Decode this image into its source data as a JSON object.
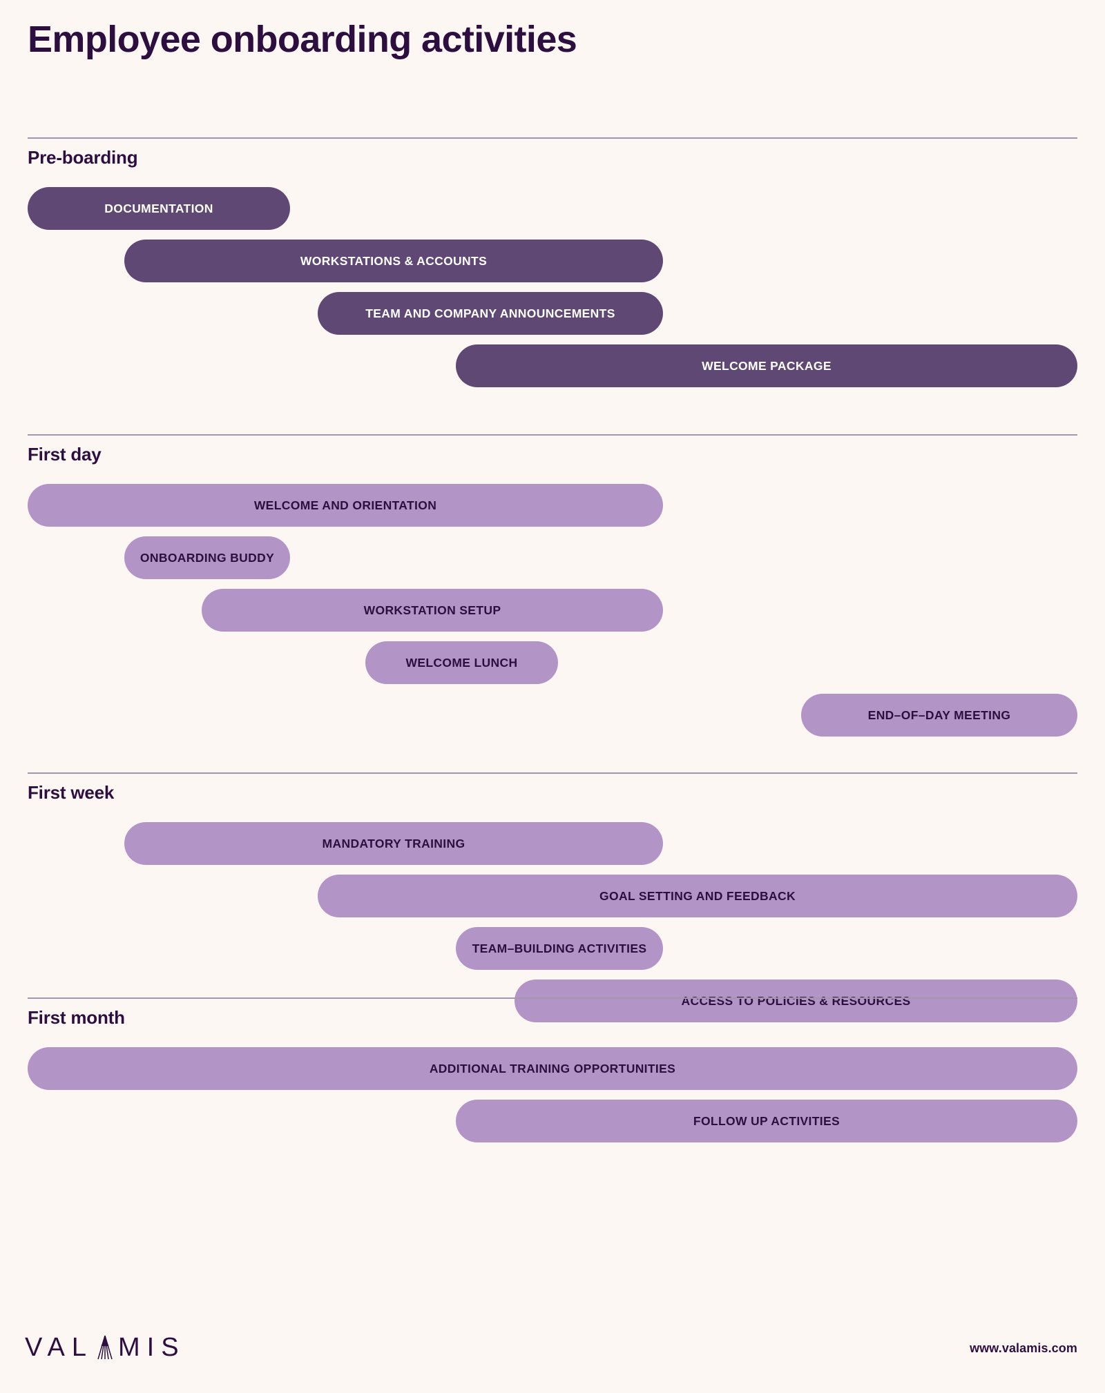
{
  "header": {
    "title": "Employee onboarding activities"
  },
  "colors": {
    "background": "#fdf7f4",
    "ink": "#2d0f3f",
    "bar_dark": "#5f4874",
    "bar_light": "#b294c6",
    "divider": "#a496ad"
  },
  "chart_data": {
    "type": "bar",
    "title": "Employee onboarding activities",
    "orientation": "horizontal",
    "xlabel": "",
    "ylabel": "",
    "grid": false,
    "legend": "none",
    "note": "Gantt-style staggered timeline bars; x extents are fractions of the 1520px content width",
    "sections": [
      {
        "label": "Pre-boarding",
        "color": "#5f4874",
        "bars": [
          {
            "label": "DOCUMENTATION",
            "start": 0.0,
            "end": 0.25
          },
          {
            "label": "WORKSTATIONS & ACCOUNTS",
            "start": 0.092,
            "end": 0.605
          },
          {
            "label": "TEAM AND COMPANY ANNOUNCEMENTS",
            "start": 0.276,
            "end": 0.605
          },
          {
            "label": "WELCOME PACKAGE",
            "start": 0.408,
            "end": 1.0
          }
        ]
      },
      {
        "label": "First day",
        "color": "#b294c6",
        "bars": [
          {
            "label": "WELCOME AND ORIENTATION",
            "start": 0.0,
            "end": 0.605
          },
          {
            "label": "ONBOARDING BUDDY",
            "start": 0.092,
            "end": 0.25
          },
          {
            "label": "WORKSTATION SETUP",
            "start": 0.166,
            "end": 0.605
          },
          {
            "label": "WELCOME LUNCH",
            "start": 0.322,
            "end": 0.505
          },
          {
            "label": "END–OF–DAY MEETING",
            "start": 0.737,
            "end": 1.0
          }
        ]
      },
      {
        "label": "First week",
        "color": "#b294c6",
        "bars": [
          {
            "label": "MANDATORY TRAINING",
            "start": 0.092,
            "end": 0.605
          },
          {
            "label": "GOAL SETTING AND FEEDBACK",
            "start": 0.276,
            "end": 1.0
          },
          {
            "label": "TEAM–BUILDING ACTIVITIES",
            "start": 0.408,
            "end": 0.605
          },
          {
            "label": "ACCESS TO POLICIES & RESOURCES",
            "start": 0.464,
            "end": 1.0
          }
        ]
      },
      {
        "label": "First month",
        "color": "#b294c6",
        "bars": [
          {
            "label": "ADDITIONAL TRAINING OPPORTUNITIES",
            "start": 0.0,
            "end": 1.0
          },
          {
            "label": "FOLLOW UP ACTIVITIES",
            "start": 0.408,
            "end": 1.0
          }
        ]
      }
    ]
  },
  "footer": {
    "brand": "VALAMIS",
    "brand_prefix": "VAL",
    "brand_suffix": "MIS",
    "url": "www.valamis.com"
  }
}
